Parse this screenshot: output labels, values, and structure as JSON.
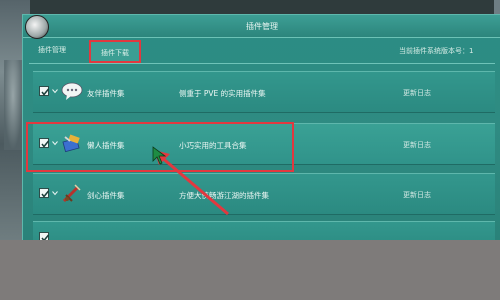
{
  "window": {
    "title": "插件管理"
  },
  "tabs": [
    {
      "label": "插件管理",
      "active": false
    },
    {
      "label": "插件下载",
      "active": true
    }
  ],
  "version_info": "当前插件系统版本号：1",
  "plugins": [
    {
      "name": "友伴插件集",
      "description": "侧重于 PVE 的实用插件集",
      "log_label": "更新日志",
      "checked": true,
      "icon": "speech-bubble-icon"
    },
    {
      "name": "懒人插件集",
      "description": "小巧实用的工具合集",
      "log_label": "更新日志",
      "checked": true,
      "icon": "tools-icon"
    },
    {
      "name": "剑心插件集",
      "description": "方便大侠畅游江湖的插件集",
      "log_label": "更新日志",
      "checked": true,
      "icon": "sword-icon"
    },
    {
      "name": "",
      "description": "",
      "log_label": "",
      "checked": true,
      "icon": ""
    }
  ],
  "colors": {
    "panel": "#2f8b82",
    "highlight": "#e2383f",
    "text": "#eef8f5"
  }
}
